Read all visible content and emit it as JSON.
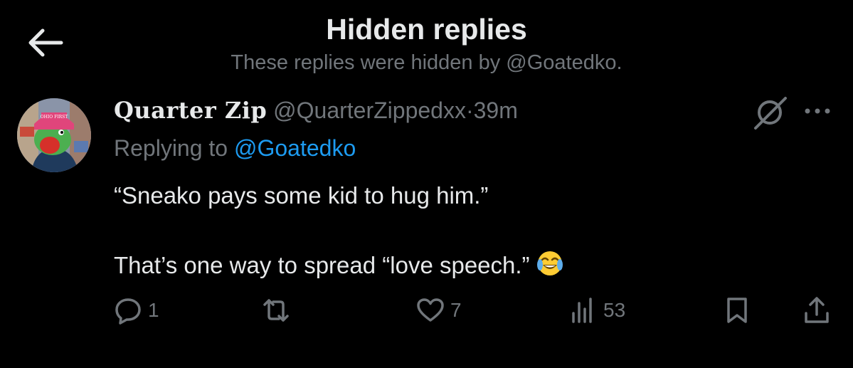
{
  "header": {
    "title": "Hidden replies",
    "subtitle": "These replies were hidden by @Goatedko."
  },
  "tweet": {
    "display_name": "Quarter Zip",
    "handle": "@QuarterZippedxx",
    "separator": "·",
    "time": "39m",
    "replying_prefix": "Replying to",
    "replying_to": "@Goatedko",
    "line1": "“Sneako pays some kid to hug him.”",
    "line2": "That’s one way to spread “love speech.”",
    "emoji_icon": "face-with-tears-of-joy",
    "avatar_badge_text": "OHIO FIRST"
  },
  "actions": {
    "replies": "1",
    "retweets": "",
    "likes": "7",
    "views": "53"
  },
  "colors": {
    "background": "#000000",
    "text_primary": "#e7e9ea",
    "text_secondary": "#71767b",
    "accent": "#1d9bf0"
  }
}
